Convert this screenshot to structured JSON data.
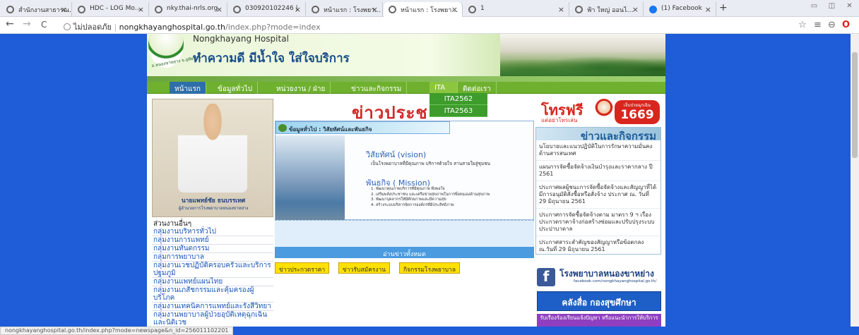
{
  "browser": {
    "tabs": [
      {
        "label": "สำนักงานสาธารณ…"
      },
      {
        "label": "HDC - LOG Mo…"
      },
      {
        "label": "nky.thai-nrls.org"
      },
      {
        "label": "030920102246 |"
      },
      {
        "label": "หน้าแรก : โรงพยา…"
      },
      {
        "label": "หน้าแรก : โรงพยา…"
      },
      {
        "label": "1"
      },
      {
        "label": "ฟ้า ใหญ่ ออนไ…"
      },
      {
        "label": "(1) Facebook"
      }
    ],
    "new_tab": "+",
    "window_controls": {
      "minimize": "▭",
      "maximize": "◫",
      "close": "✕"
    },
    "nav": {
      "back": "←",
      "forward": "→",
      "reload": "C"
    },
    "security_label": "ไม่ปลอดภัย",
    "url_host": "nongkhayanghospital.go.th",
    "url_path": "/index.php?mode=index",
    "toolbar_icons": {
      "star": "☆",
      "menu": "≡",
      "account": "⊖",
      "opera": "O"
    }
  },
  "header": {
    "hospital_name": "Nongkhayang Hospital",
    "slogan": "ทำความดี มีน้ำใจ ใส่ใจบริการ",
    "logo_text": "อ.หนองขาหย่าง จ.อุทัยธานี"
  },
  "menu": {
    "items": [
      "หน้าแรก",
      "ข้อมูลทั่วไป",
      "หน่วยงาน / ฝ่าย",
      "ข่าวและกิจกรรม",
      "ITA",
      "ติดต่อเรา"
    ],
    "ita_dropdown": [
      "ITA2562",
      "ITA2563"
    ]
  },
  "profile": {
    "name": "นายแพทย์ชัย ธนบรรเทศ",
    "role": "ผู้อำนวยการโรงพยาบาลหนองขาหย่าง"
  },
  "sidebar": {
    "heading": "ส่วนงานอื่นๆ",
    "links": [
      "กลุ่มงานบริหารทั่วไป",
      "กลุ่มงานการแพทย์",
      "กลุ่มงานทันตกรรม",
      "กลุ่มการพยาบาล",
      "กลุ่มงานเวชปฏิบัติครอบครัวและบริการปฐมภูมิ",
      "กลุ่มงานแพทย์แผนไทย",
      "กลุ่มงานเภสัชกรรมและคุ้มครองผู้บริโภค",
      "กลุ่มงานเทคนิคการแพทย์และรังสีวิทยา",
      "กลุ่มงานพยาบาลผู้ป่วยอุบัติเหตุฉุกเฉินและนิติเวช"
    ]
  },
  "main": {
    "banner": "ข่าวประช",
    "vision_section_title": "ข้อมูลทั่วไป : วิสัยทัศน์และพันธกิจ",
    "vision_title": "วิสัยทัศน์ (vision)",
    "vision_text": "เป็นโรงพยาบาลที่มีคุณภาพ บริการด้วยใจ สานสายใยสู่ชุมชน",
    "mission_title": "พันธกิจ ( Mission)",
    "mission_items": [
      "1. พัฒนาคุณภาพบริการที่มีคุณภาพ พึงพอใจ",
      "2. เสริมพลังประชาชน และเครือข่ายสุขภาพในการพึ่งตนเองด้านสุขภาพ",
      "3. พัฒนาบุคลากรให้มีศักยภาพและมีความสุข",
      "4. สร้างระบบบริหารจัดการองค์กรที่มีประสิทธิภาพ"
    ],
    "read_all": "อ่านข่าวทั้งหมด",
    "news_buttons": [
      "ข่าวประกวดราคา",
      "ข่าวรับสมัครงาน",
      "กิจกรรมโรงพยาบาล"
    ]
  },
  "right": {
    "hotline_free": "โทรฟรี",
    "hotline_sub": "แต่อย่าโทรเล่น",
    "hotline_badge_top": "เจ็บป่วยฉุกเฉิน",
    "hotline_number": "1669",
    "activity_title": "ข่าวและกิจกรรม",
    "activity_items": [
      "นโยบายและแนวปฏิบัติในการรักษาความมั่นคงด้านสารสนเทศ",
      "แผนการจัดซื้อจัดจ้างเงินบำรุงและราคากลาง ปี 2561",
      "ประกาศผลผู้ชนะการจัดซื้อจัดจ้างและสัญญาที่ได้มีการอนุมัติสั่งซื้อหรือสั่งจ้าง ประกาศ ณ. วันที่ 29 มิถุนายน 2561",
      "ประกาศการจัดซื้อจัดจ้างตาม มาตรา 9 ฯ เรื่องประกวดราคาจ้างก่อสร้างซ่อมและปรับปรุงระบบประปาบาดาล",
      "ประกาศสาระสำคัญของสัญญาหรือข้อตกลง ณ.วันที่ 29 มิถุนายน 2561"
    ],
    "facebook_title": "โรงพยาบาลหนองขาหย่าง",
    "facebook_url": "facebook.com/nongkhayanghospital.go.th/",
    "health_button": "คลังสื่อ กองสุขศึกษา",
    "complaint_button": "รับเรื่องร้องเรียนแจ้งปัญหา หรือแนะนำการให้บริการ"
  },
  "status_url": "nongkhayanghospital.go.th/index.php?mode=newspage&n_id=256011102201"
}
